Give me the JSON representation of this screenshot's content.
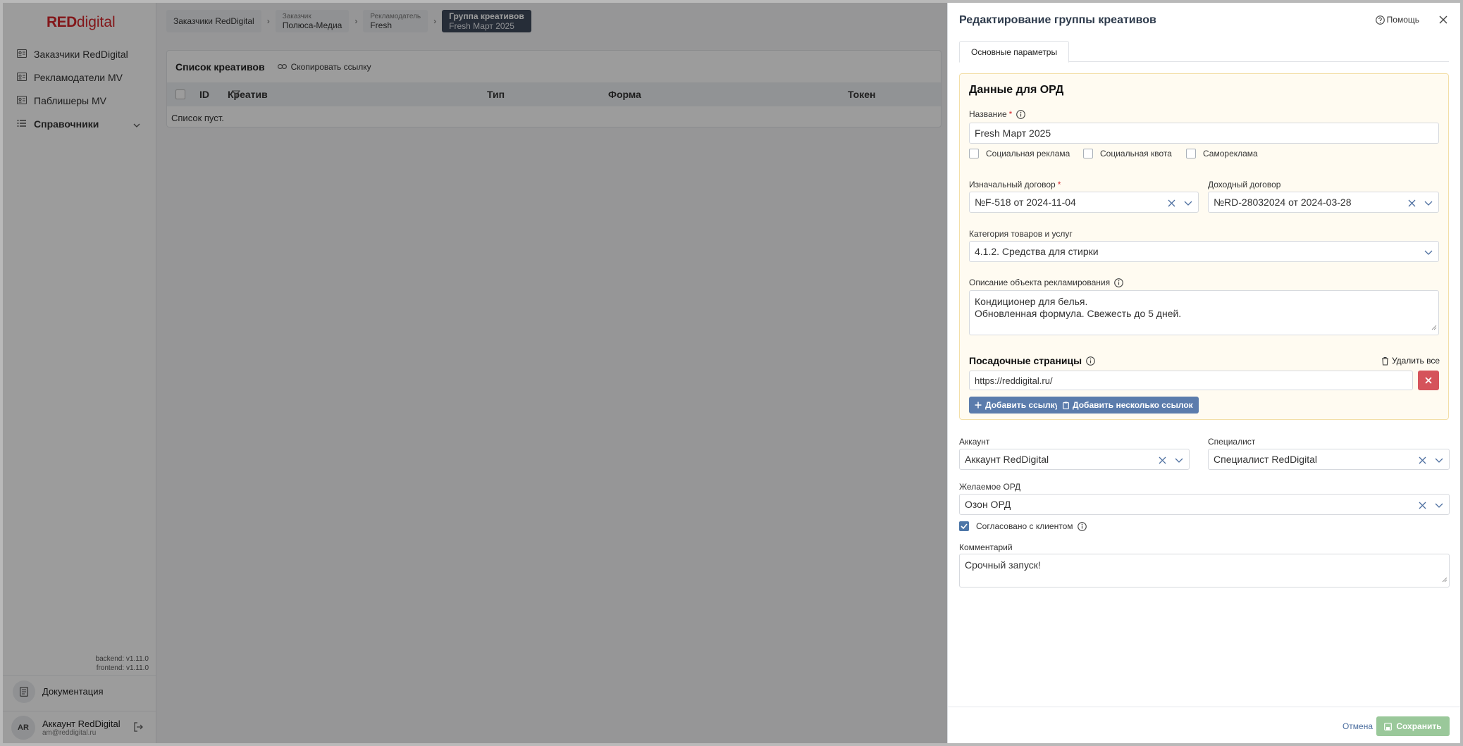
{
  "brand": {
    "logo_bold": "RED",
    "logo_light": "digital"
  },
  "sidebar": {
    "items": [
      {
        "label": "Заказчики RedDigital",
        "icon": "id-card-icon"
      },
      {
        "label": "Рекламодатели MV",
        "icon": "id-card-icon"
      },
      {
        "label": "Паблишеры MV",
        "icon": "id-card-icon"
      },
      {
        "label": "Справочники",
        "icon": "list-icon"
      }
    ],
    "versions": {
      "backend": "backend: v1.11.0",
      "frontend": "frontend: v1.11.0"
    },
    "docs_label": "Документация",
    "user": {
      "initials": "AR",
      "name": "Аккаунт RedDigital",
      "email": "am@reddigital.ru"
    }
  },
  "breadcrumbs": [
    {
      "label": "Заказчики RedDigital"
    },
    {
      "sub": "Заказчик",
      "value": "Полюса-Медиа"
    },
    {
      "sub": "Рекламодатель",
      "value": "Fresh"
    },
    {
      "sub": "Группа креативов",
      "value": "Fresh Март 2025"
    }
  ],
  "creatives": {
    "title": "Список креативов",
    "copy_link": "Скопировать ссылку",
    "columns": [
      "ID",
      "Креатив",
      "Тип",
      "Форма",
      "Токен"
    ],
    "empty": "Список пуст."
  },
  "drawer": {
    "title": "Редактирование группы креативов",
    "help": "Помощь",
    "tab": "Основные параметры",
    "ord": {
      "title": "Данные для ОРД",
      "name_label": "Название",
      "name_value": "Fresh Март 2025",
      "checkboxes": [
        "Социальная реклама",
        "Социальная квота",
        "Самореклама"
      ],
      "initial_contract_label": "Изначальный договор",
      "initial_contract_value": "№F-518 от 2024-11-04",
      "income_contract_label": "Доходный договор",
      "income_contract_value": "№RD-28032024 от 2024-03-28",
      "category_label": "Категория товаров и услуг",
      "category_value": "4.1.2. Средства для стирки",
      "description_label": "Описание объекта рекламирования",
      "description_line1": "Кондиционер для белья.",
      "description_line2": "Обновленная формула. Свежесть до 5 дней.",
      "landing_title": "Посадочные страницы",
      "delete_all": "Удалить все",
      "landing_url": "https://reddigital.ru/",
      "add_link": "Добавить ссылку",
      "add_multiple": "Добавить несколько ссылок"
    },
    "account_label": "Аккаунт",
    "account_value": "Аккаунт RedDigital",
    "specialist_label": "Специалист",
    "specialist_value": "Специалист RedDigital",
    "desired_ord_label": "Желаемое ОРД",
    "desired_ord_value": "Озон ОРД",
    "agreed_label": "Согласовано с клиентом",
    "comment_label": "Комментарий",
    "comment_value": "Срочный запуск!",
    "cancel": "Отмена",
    "save": "Сохранить"
  },
  "colors": {
    "brand_red": "#d6262c",
    "primary_blue": "#5b7cac",
    "danger_red": "#d5535b",
    "save_green": "#9ac89a"
  }
}
